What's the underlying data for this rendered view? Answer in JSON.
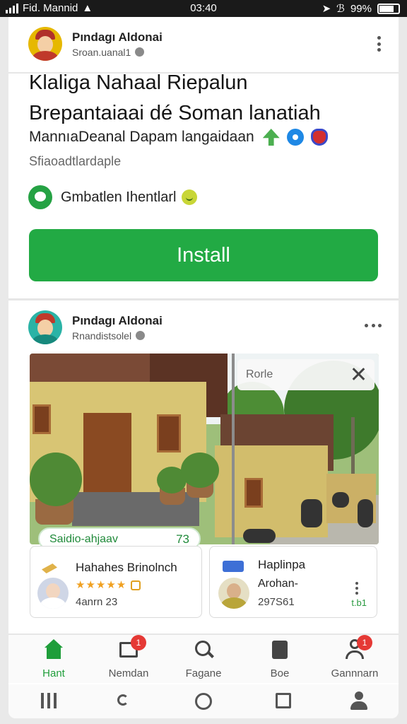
{
  "status_bar": {
    "carrier": "Fid. Mannid",
    "time": "03:40",
    "battery": "99%"
  },
  "post1": {
    "author": "Pındagı Aldonai",
    "subline": "Sroan.uanal1",
    "headline_line1": "Klaliga Nahaal Riepalun",
    "headline_line2": "Brepantaiaai dé Soman lanatiah",
    "description": "MannıaDeanal Dapam langaidaan",
    "handle": "Sfiaoadtlardaple",
    "whatsapp_label": "Gmbatlen Ihentlarl",
    "install_label": "Install"
  },
  "post2": {
    "author": "Pındagı Aldonai",
    "subline": "Rnandistsolel",
    "search_chip_label": "Rorle",
    "tag_label": "Saidio-ahjaav",
    "tag_number": "73",
    "card1": {
      "title": "Hahahes Brinolnch",
      "rating_stars": "★★★★★",
      "rating_value": 5,
      "meta": "4anrn 23"
    },
    "card2": {
      "title": "Haplinpa",
      "subtitle": "Arohan-",
      "meta": "297S61",
      "tag": "t.b1"
    }
  },
  "bottom_nav": {
    "items": [
      {
        "label": "Hant",
        "icon": "home-icon",
        "active": true,
        "badge": ""
      },
      {
        "label": "Nemdan",
        "icon": "news-icon",
        "active": false,
        "badge": "1"
      },
      {
        "label": "Fagane",
        "icon": "search-icon",
        "active": false,
        "badge": ""
      },
      {
        "label": "Boe",
        "icon": "store-icon",
        "active": false,
        "badge": ""
      },
      {
        "label": "Gannnarn",
        "icon": "people-icon",
        "active": false,
        "badge": "1"
      }
    ]
  },
  "colors": {
    "accent_green": "#22aa44",
    "badge_red": "#e53935"
  }
}
